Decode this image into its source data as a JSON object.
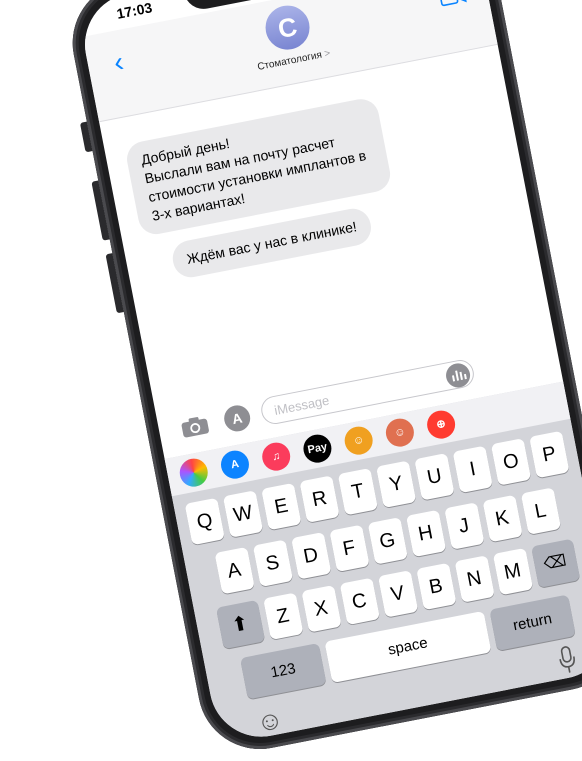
{
  "status": {
    "time": "17:03"
  },
  "header": {
    "contact_name": "Стоматология",
    "chevron": ">",
    "avatar_letter": "C"
  },
  "messages": [
    {
      "text": "Добрый день!\nВыслали вам на почту расчет стоимости установки имплантов в 3-х вариантах!"
    },
    {
      "text": "Ждём вас у нас в клинике!"
    }
  ],
  "composer": {
    "placeholder": "iMessage"
  },
  "app_strip": [
    {
      "icon": "photos-icon",
      "label": "",
      "color": "#ffffff"
    },
    {
      "icon": "app-store-icon",
      "label": "A",
      "color": "#0d84ff"
    },
    {
      "icon": "music-icon",
      "label": "♫",
      "color": "#fb3c5c"
    },
    {
      "icon": "apple-pay-icon",
      "label": "Pay",
      "color": "#000000"
    },
    {
      "icon": "memoji-icon",
      "label": "☺",
      "color": "#f0a020"
    },
    {
      "icon": "sticker-icon",
      "label": "☺",
      "color": "#e07050"
    },
    {
      "icon": "search-web-icon",
      "label": "⊕",
      "color": "#ff3b30"
    }
  ],
  "keyboard": {
    "row1": [
      "Q",
      "W",
      "E",
      "R",
      "T",
      "Y",
      "U",
      "I",
      "O",
      "P"
    ],
    "row2": [
      "A",
      "S",
      "D",
      "F",
      "G",
      "H",
      "J",
      "K",
      "L"
    ],
    "row3": [
      "Z",
      "X",
      "C",
      "V",
      "B",
      "N",
      "M"
    ],
    "numbers_label": "123",
    "space_label": "space",
    "return_label": "return"
  },
  "colors": {
    "accent": "#0a84ff",
    "bubble": "#e9e9eb",
    "keyboard_bg": "#d3d4d9"
  }
}
